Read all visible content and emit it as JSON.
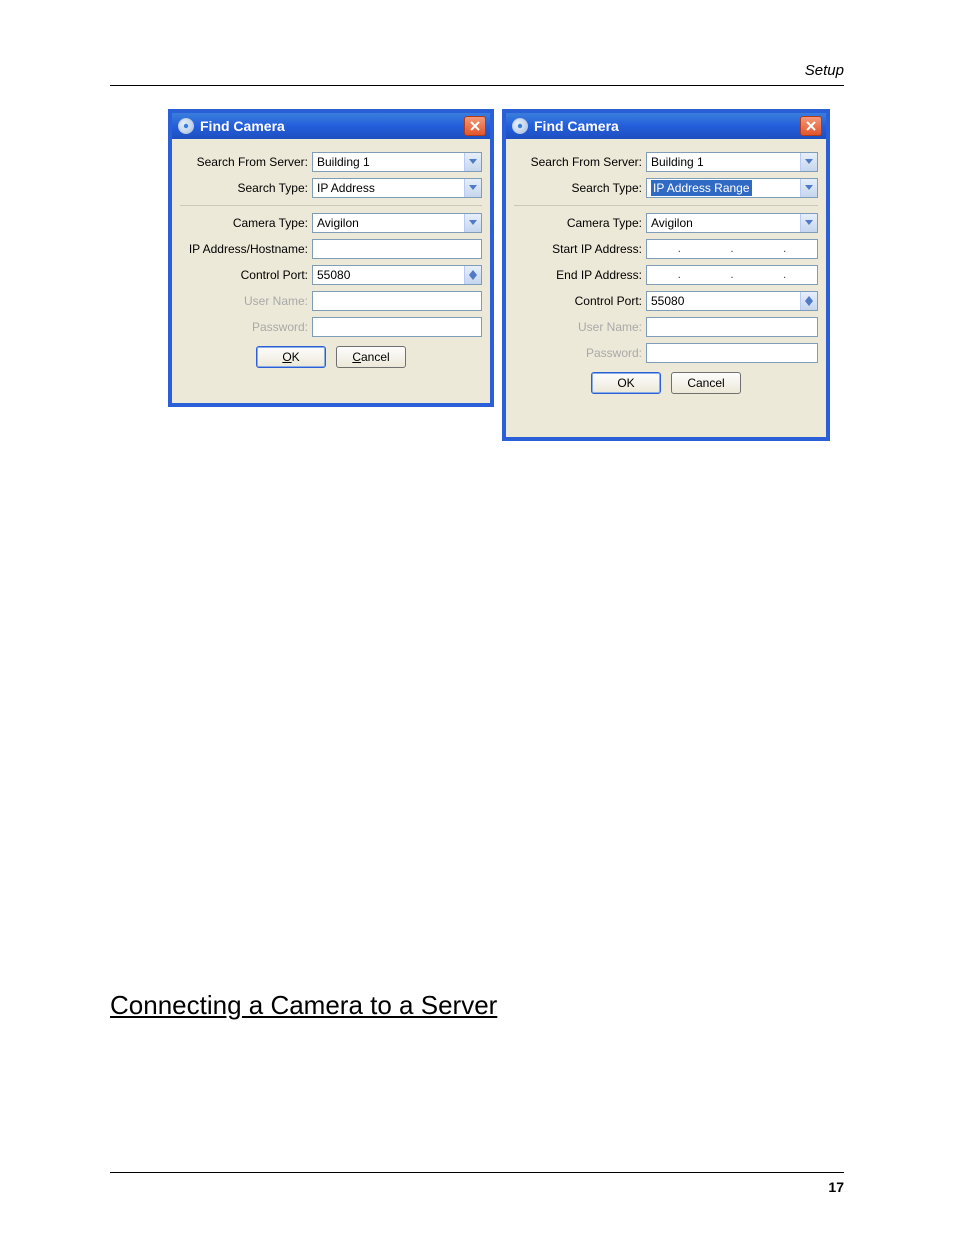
{
  "header": {
    "category": "Setup"
  },
  "dialog1": {
    "title": "Find Camera",
    "labels": {
      "search_from_server": "Search From Server:",
      "search_type": "Search Type:",
      "camera_type": "Camera Type:",
      "ip_hostname": "IP Address/Hostname:",
      "control_port": "Control Port:",
      "user_name": "User Name:",
      "password": "Password:"
    },
    "values": {
      "search_from_server": "Building 1",
      "search_type": "IP Address",
      "camera_type": "Avigilon",
      "ip_hostname": "",
      "control_port": "55080",
      "user_name": "",
      "password": ""
    },
    "buttons": {
      "ok_pre": "O",
      "ok_rest": "K",
      "cancel_pre": "C",
      "cancel_rest": "ancel"
    }
  },
  "dialog2": {
    "title": "Find Camera",
    "labels": {
      "search_from_server": "Search From Server:",
      "search_type": "Search Type:",
      "camera_type": "Camera Type:",
      "start_ip": "Start IP Address:",
      "end_ip": "End IP Address:",
      "control_port": "Control Port:",
      "user_name": "User Name:",
      "password": "Password:"
    },
    "values": {
      "search_from_server": "Building 1",
      "search_type": "IP Address Range",
      "camera_type": "Avigilon",
      "control_port": "55080",
      "user_name": "",
      "password": ""
    },
    "buttons": {
      "ok": "OK",
      "cancel": "Cancel"
    }
  },
  "section": {
    "heading": "Connecting a Camera to a Server"
  },
  "footer": {
    "page_number": "17"
  }
}
